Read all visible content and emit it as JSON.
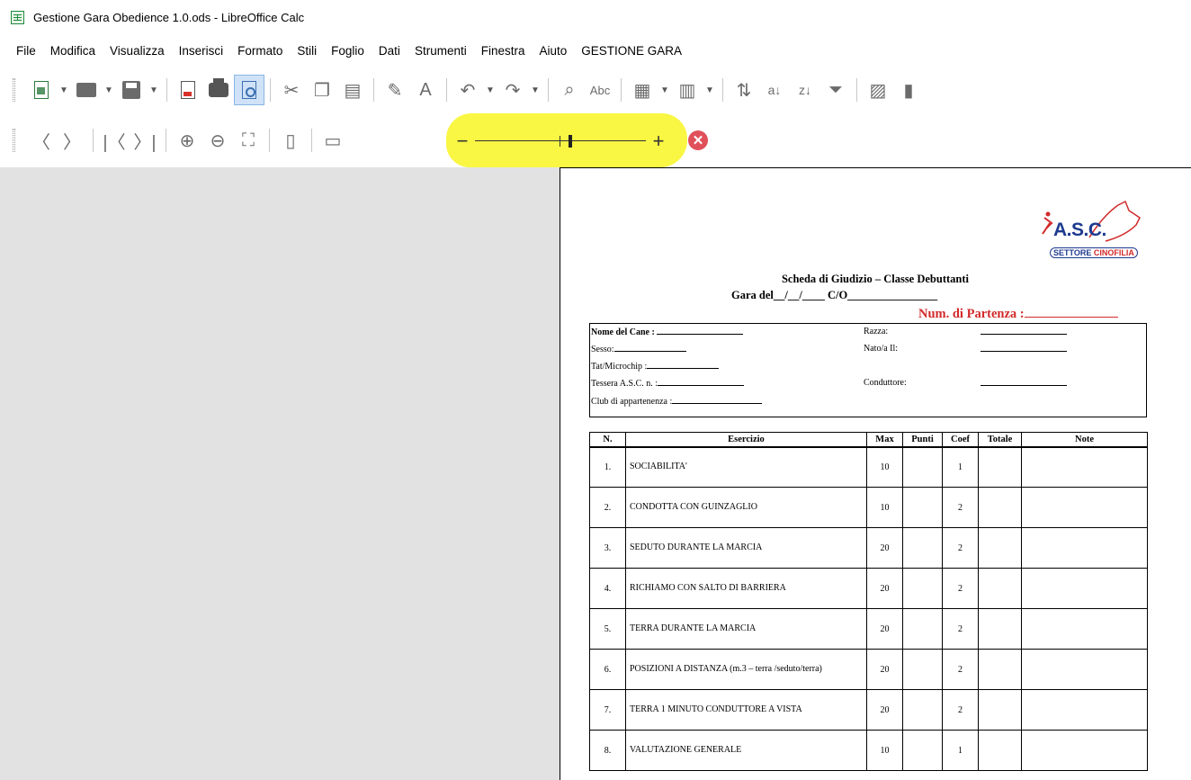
{
  "window": {
    "title": "Gestione Gara Obedience 1.0.ods - LibreOffice Calc"
  },
  "menu": [
    "File",
    "Modifica",
    "Visualizza",
    "Inserisci",
    "Formato",
    "Stili",
    "Foglio",
    "Dati",
    "Strumenti",
    "Finestra",
    "Aiuto",
    "GESTIONE GARA"
  ],
  "toolbar1": {
    "icons": [
      "new-spreadsheet-icon",
      "open-folder-icon",
      "save-icon",
      "export-pdf-icon",
      "print-icon",
      "print-preview-icon",
      "cut-icon",
      "copy-icon",
      "paste-icon",
      "clone-formatting-icon",
      "clear-formatting-icon",
      "undo-icon",
      "redo-icon",
      "find-replace-icon",
      "spelling-icon",
      "rows-icon",
      "columns-icon",
      "sort-icon",
      "sort-ascending-icon",
      "sort-descending-icon",
      "autofilter-icon",
      "image-icon",
      "chart-icon"
    ]
  },
  "toolbar2": {
    "icons": [
      "previous-page-icon",
      "next-page-icon",
      "first-page-icon",
      "last-page-icon",
      "zoom-in-icon",
      "zoom-out-icon",
      "full-screen-icon",
      "page-format-icon",
      "margins-icon"
    ],
    "zoom": {
      "minus": "−",
      "plus": "+",
      "level_fraction": 0.56
    },
    "close_preview": "✕"
  },
  "colors": {
    "highlight": "#f9f53a",
    "accent_red": "#d32a2a",
    "logo_blue": "#1d3a8f",
    "preview_bg": "#e2e2e2"
  },
  "document": {
    "logo": {
      "text": "A.S.C.",
      "subtitle_blue": "SETTORE ",
      "subtitle_red": "CINOFILIA"
    },
    "title": "Scheda di Giudizio – Classe Debuttanti",
    "gara_line": "Gara del__/__/____ C/O________________",
    "num_partenza": "Num. di Partenza :",
    "info": {
      "nome_cane": "Nome del Cane :",
      "razza": "Razza:",
      "sesso": "Sesso:",
      "nato": "Nato/a Il:",
      "tat": "Tat/Microchip :",
      "tessera": "Tessera A.S.C. n. :",
      "conduttore": "Conduttore:",
      "club": "Club di appartenenza :"
    },
    "table": {
      "headers": [
        "N.",
        "Esercizio",
        "Max",
        "Punti",
        "Coef",
        "Totale",
        "Note"
      ],
      "rows": [
        {
          "n": "1.",
          "esercizio": "SOCIABILITA'",
          "max": "10",
          "coef": "1"
        },
        {
          "n": "2.",
          "esercizio": "CONDOTTA CON GUINZAGLIO",
          "max": "10",
          "coef": "2"
        },
        {
          "n": "3.",
          "esercizio": "SEDUTO DURANTE LA MARCIA",
          "max": "20",
          "coef": "2"
        },
        {
          "n": "4.",
          "esercizio": "RICHIAMO CON SALTO DI BARRIERA",
          "max": "20",
          "coef": "2"
        },
        {
          "n": "5.",
          "esercizio": "TERRA DURANTE LA MARCIA",
          "max": "20",
          "coef": "2"
        },
        {
          "n": "6.",
          "esercizio": "POSIZIONI A DISTANZA (m.3 – terra /seduto/terra)",
          "max": "20",
          "coef": "2"
        },
        {
          "n": "7.",
          "esercizio": "TERRA 1 MINUTO CONDUTTORE A VISTA",
          "max": "20",
          "coef": "2"
        },
        {
          "n": "8.",
          "esercizio": "VALUTAZIONE GENERALE",
          "max": "10",
          "coef": "1"
        }
      ]
    }
  }
}
